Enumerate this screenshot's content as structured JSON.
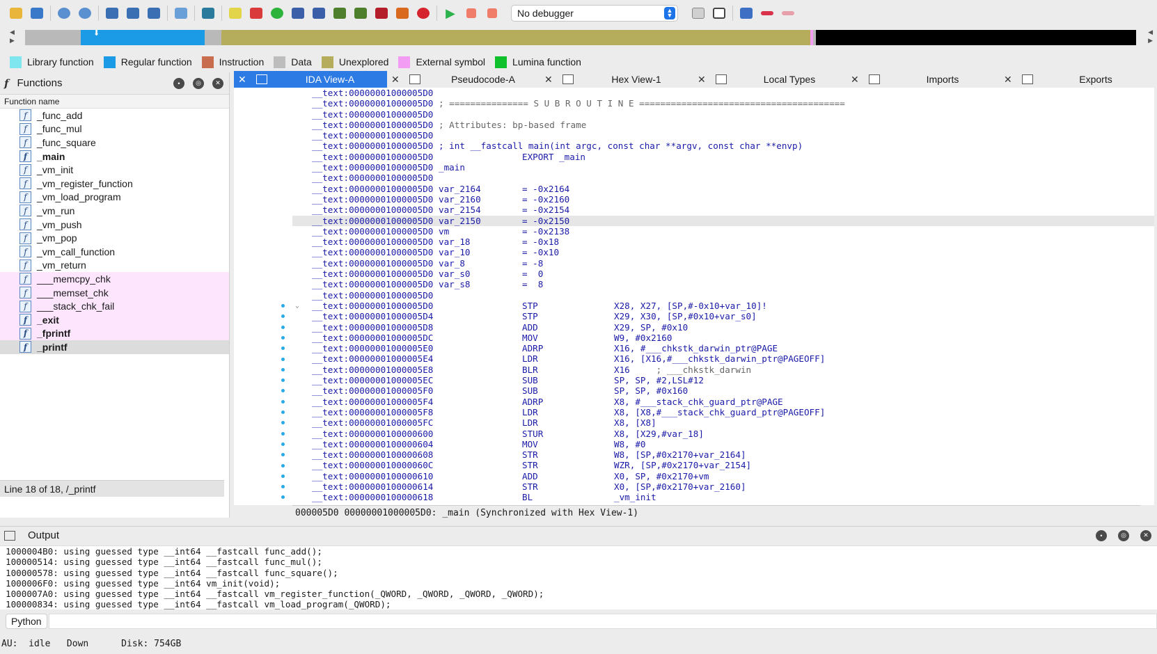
{
  "toolbar": {
    "debugger": "No debugger"
  },
  "legend": [
    {
      "label": "Library function",
      "color": "#7fe6f0"
    },
    {
      "label": "Regular function",
      "color": "#1b9ae6"
    },
    {
      "label": "Instruction",
      "color": "#c86d4e"
    },
    {
      "label": "Data",
      "color": "#bdbdbd"
    },
    {
      "label": "Unexplored",
      "color": "#b5ad5c"
    },
    {
      "label": "External symbol",
      "color": "#f39cf3"
    },
    {
      "label": "Lumina function",
      "color": "#10c12e"
    }
  ],
  "functions": {
    "title": "Functions",
    "column": "Function name",
    "items": [
      {
        "name": "_func_add",
        "style": ""
      },
      {
        "name": "_func_mul",
        "style": ""
      },
      {
        "name": "_func_square",
        "style": ""
      },
      {
        "name": "_main",
        "style": "bold"
      },
      {
        "name": "_vm_init",
        "style": ""
      },
      {
        "name": "_vm_register_function",
        "style": ""
      },
      {
        "name": "_vm_load_program",
        "style": ""
      },
      {
        "name": "_vm_run",
        "style": ""
      },
      {
        "name": "_vm_push",
        "style": ""
      },
      {
        "name": "_vm_pop",
        "style": ""
      },
      {
        "name": "_vm_call_function",
        "style": ""
      },
      {
        "name": "_vm_return",
        "style": ""
      },
      {
        "name": "___memcpy_chk",
        "style": "extern"
      },
      {
        "name": "___memset_chk",
        "style": "extern"
      },
      {
        "name": "___stack_chk_fail",
        "style": "extern"
      },
      {
        "name": "_exit",
        "style": "extern bold"
      },
      {
        "name": "_fprintf",
        "style": "extern bold"
      },
      {
        "name": "_printf",
        "style": "extern bold selected"
      }
    ],
    "status": "Line 18 of 18, /_printf"
  },
  "tabs": [
    {
      "label": "IDA View-A",
      "active": true
    },
    {
      "label": "Pseudocode-A",
      "active": false
    },
    {
      "label": "Hex View-1",
      "active": false
    },
    {
      "label": "Local Types",
      "active": false
    },
    {
      "label": "Imports",
      "active": false
    },
    {
      "label": "Exports",
      "active": false
    }
  ],
  "disasm": [
    {
      "addr": "__text:00000001000005D0",
      "kind": "blank"
    },
    {
      "addr": "__text:00000001000005D0",
      "kind": "comment",
      "text": "; =============== S U B R O U T I N E ======================================="
    },
    {
      "addr": "__text:00000001000005D0",
      "kind": "blank"
    },
    {
      "addr": "__text:00000001000005D0",
      "kind": "comment",
      "text": "; Attributes: bp-based frame"
    },
    {
      "addr": "__text:00000001000005D0",
      "kind": "blank"
    },
    {
      "addr": "__text:00000001000005D0",
      "kind": "label",
      "text": "; int __fastcall main(int argc, const char **argv, const char **envp)"
    },
    {
      "addr": "__text:00000001000005D0",
      "kind": "export",
      "text": "EXPORT _main"
    },
    {
      "addr": "__text:00000001000005D0",
      "kind": "label",
      "text": "_main"
    },
    {
      "addr": "__text:00000001000005D0",
      "kind": "blank"
    },
    {
      "addr": "__text:00000001000005D0",
      "kind": "var",
      "name": "var_2164",
      "value": "= -0x2164"
    },
    {
      "addr": "__text:00000001000005D0",
      "kind": "var",
      "name": "var_2160",
      "value": "= -0x2160"
    },
    {
      "addr": "__text:00000001000005D0",
      "kind": "var",
      "name": "var_2154",
      "value": "= -0x2154"
    },
    {
      "addr": "__text:00000001000005D0",
      "kind": "var",
      "name": "var_2150",
      "value": "= -0x2150",
      "hl": true
    },
    {
      "addr": "__text:00000001000005D0",
      "kind": "var",
      "name": "vm",
      "value": "= -0x2138"
    },
    {
      "addr": "__text:00000001000005D0",
      "kind": "var",
      "name": "var_18",
      "value": "= -0x18"
    },
    {
      "addr": "__text:00000001000005D0",
      "kind": "var",
      "name": "var_10",
      "value": "= -0x10"
    },
    {
      "addr": "__text:00000001000005D0",
      "kind": "var",
      "name": "var_8",
      "value": "= -8"
    },
    {
      "addr": "__text:00000001000005D0",
      "kind": "var",
      "name": "var_s0",
      "value": "=  0"
    },
    {
      "addr": "__text:00000001000005D0",
      "kind": "var",
      "name": "var_s8",
      "value": "=  8"
    },
    {
      "addr": "__text:00000001000005D0",
      "kind": "blank"
    },
    {
      "addr": "__text:00000001000005D0",
      "kind": "insn",
      "mn": "STP",
      "op": "X28, X27, [SP,#-0x10+var_10]!",
      "dot": true,
      "chev": true
    },
    {
      "addr": "__text:00000001000005D4",
      "kind": "insn",
      "mn": "STP",
      "op": "X29, X30, [SP,#0x10+var_s0]",
      "dot": true
    },
    {
      "addr": "__text:00000001000005D8",
      "kind": "insn",
      "mn": "ADD",
      "op": "X29, SP, #0x10",
      "dot": true
    },
    {
      "addr": "__text:00000001000005DC",
      "kind": "insn",
      "mn": "MOV",
      "op": "W9, #0x2160",
      "dot": true
    },
    {
      "addr": "__text:00000001000005E0",
      "kind": "insn",
      "mn": "ADRP",
      "op": "X16, #___chkstk_darwin_ptr@PAGE",
      "dot": true
    },
    {
      "addr": "__text:00000001000005E4",
      "kind": "insn",
      "mn": "LDR",
      "op": "X16, [X16,#___chkstk_darwin_ptr@PAGEOFF]",
      "dot": true
    },
    {
      "addr": "__text:00000001000005E8",
      "kind": "insn",
      "mn": "BLR",
      "op": "X16",
      "sub": "     ; ___chkstk_darwin",
      "dot": true
    },
    {
      "addr": "__text:00000001000005EC",
      "kind": "insn",
      "mn": "SUB",
      "op": "SP, SP, #2,LSL#12",
      "dot": true
    },
    {
      "addr": "__text:00000001000005F0",
      "kind": "insn",
      "mn": "SUB",
      "op": "SP, SP, #0x160",
      "dot": true
    },
    {
      "addr": "__text:00000001000005F4",
      "kind": "insn",
      "mn": "ADRP",
      "op": "X8, #___stack_chk_guard_ptr@PAGE",
      "dot": true
    },
    {
      "addr": "__text:00000001000005F8",
      "kind": "insn",
      "mn": "LDR",
      "op": "X8, [X8,#___stack_chk_guard_ptr@PAGEOFF]",
      "dot": true
    },
    {
      "addr": "__text:00000001000005FC",
      "kind": "insn",
      "mn": "LDR",
      "op": "X8, [X8]",
      "dot": true
    },
    {
      "addr": "__text:0000000100000600",
      "kind": "insn",
      "mn": "STUR",
      "op": "X8, [X29,#var_18]",
      "dot": true
    },
    {
      "addr": "__text:0000000100000604",
      "kind": "insn",
      "mn": "MOV",
      "op": "W8, #0",
      "dot": true
    },
    {
      "addr": "__text:0000000100000608",
      "kind": "insn",
      "mn": "STR",
      "op": "W8, [SP,#0x2170+var_2164]",
      "dot": true
    },
    {
      "addr": "__text:000000010000060C",
      "kind": "insn",
      "mn": "STR",
      "op": "WZR, [SP,#0x2170+var_2154]",
      "dot": true
    },
    {
      "addr": "__text:0000000100000610",
      "kind": "insn",
      "mn": "ADD",
      "op": "X0, SP, #0x2170+vm",
      "dot": true
    },
    {
      "addr": "__text:0000000100000614",
      "kind": "insn",
      "mn": "STR",
      "op": "X0, [SP,#0x2170+var_2160]",
      "dot": true
    },
    {
      "addr": "__text:0000000100000618",
      "kind": "insn",
      "mn": "BL",
      "op": "_vm_init",
      "dot": true
    }
  ],
  "sync_status": "000005D0 00000001000005D0: _main (Synchronized with Hex View-1)",
  "output": {
    "title": "Output",
    "lines": [
      "1000004B0: using guessed type __int64 __fastcall func_add();",
      "100000514: using guessed type __int64 __fastcall func_mul();",
      "100000578: using guessed type __int64 __fastcall func_square();",
      "1000006F0: using guessed type __int64 vm_init(void);",
      "1000007A0: using guessed type __int64 __fastcall vm_register_function(_QWORD, _QWORD, _QWORD, _QWORD);",
      "100000834: using guessed type __int64 __fastcall vm_load_program(_QWORD);"
    ],
    "python_label": "Python"
  },
  "statusbar": "AU:  idle   Down      Disk: 754GB"
}
